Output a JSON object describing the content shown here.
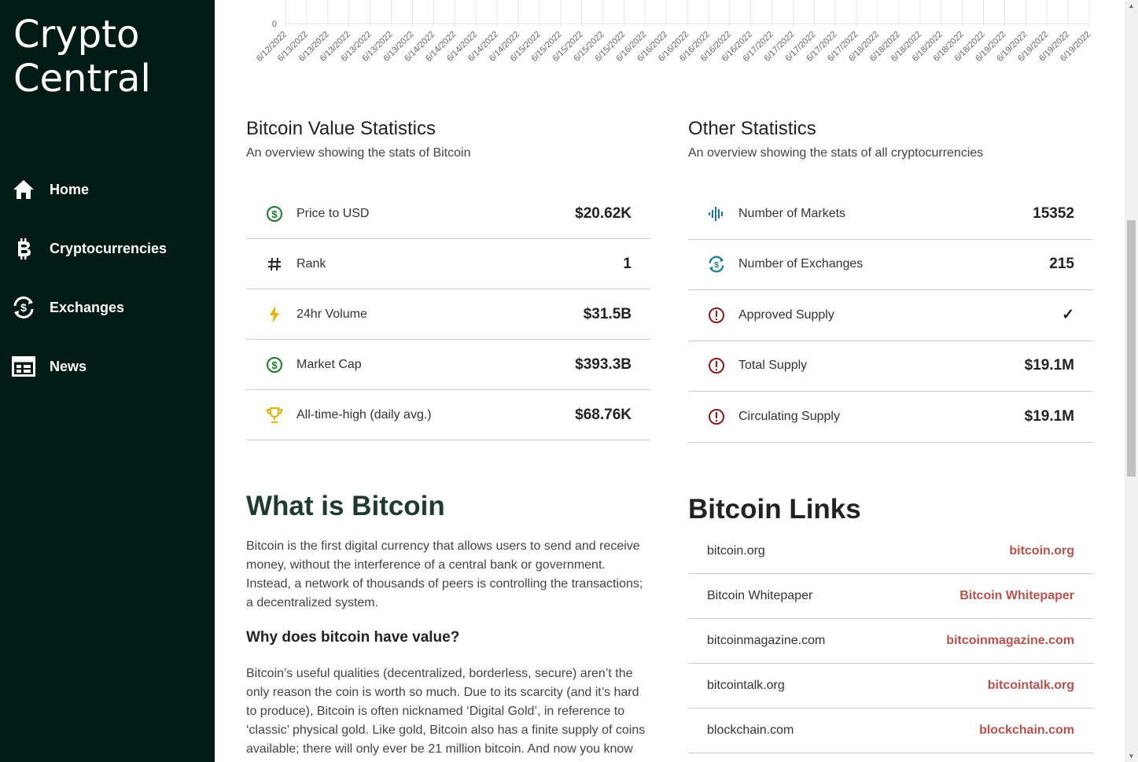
{
  "brand": {
    "line1": "Crypto",
    "line2": "Central"
  },
  "nav": [
    {
      "label": "Home",
      "icon": "home-icon"
    },
    {
      "label": "Cryptocurrencies",
      "icon": "bitcoin-icon"
    },
    {
      "label": "Exchanges",
      "icon": "exchange-icon"
    },
    {
      "label": "News",
      "icon": "news-icon"
    }
  ],
  "chart_data": {
    "type": "line",
    "y_tick_visible": "0",
    "x": [
      "6/12/2022",
      "6/13/2022",
      "6/13/2022",
      "6/13/2022",
      "6/13/2022",
      "6/13/2022",
      "6/13/2022",
      "6/14/2022",
      "6/14/2022",
      "6/14/2022",
      "6/14/2022",
      "6/14/2022",
      "6/15/2022",
      "6/15/2022",
      "6/15/2022",
      "6/15/2022",
      "6/15/2022",
      "6/16/2022",
      "6/16/2022",
      "6/16/2022",
      "6/16/2022",
      "6/16/2022",
      "6/16/2022",
      "6/17/2022",
      "6/17/2022",
      "6/17/2022",
      "6/17/2022",
      "6/17/2022",
      "6/18/2022",
      "6/18/2022",
      "6/18/2022",
      "6/18/2022",
      "6/18/2022",
      "6/18/2022",
      "6/19/2022",
      "6/19/2022",
      "6/19/2022",
      "6/19/2022",
      "6/19/2022"
    ]
  },
  "bitcoin_stats": {
    "title": "Bitcoin Value Statistics",
    "subtitle": "An overview showing the stats of Bitcoin",
    "rows": [
      {
        "label": "Price to USD",
        "value": "$20.62K",
        "icon": "dollar-circle-icon",
        "color": "#1e7a2e"
      },
      {
        "label": "Rank",
        "value": "1",
        "icon": "hash-icon",
        "color": "#222222"
      },
      {
        "label": "24hr Volume",
        "value": "$31.5B",
        "icon": "lightning-icon",
        "color": "#e0b400"
      },
      {
        "label": "Market Cap",
        "value": "$393.3B",
        "icon": "dollar-circle-icon",
        "color": "#1e7a2e"
      },
      {
        "label": "All-time-high (daily avg.)",
        "value": "$68.76K",
        "icon": "trophy-icon",
        "color": "#e0b400"
      }
    ]
  },
  "other_stats": {
    "title": "Other Statistics",
    "subtitle": "An overview showing the stats of all cryptocurrencies",
    "rows": [
      {
        "label": "Number of Markets",
        "value": "15352",
        "icon": "soundwave-icon",
        "color": "#1a7a8a"
      },
      {
        "label": "Number of Exchanges",
        "value": "215",
        "icon": "exchange-icon",
        "color": "#1a7a8a"
      },
      {
        "label": "Approved Supply",
        "value": "✓",
        "icon": "exclamation-circle-icon",
        "color": "#8a1a1a"
      },
      {
        "label": "Total Supply",
        "value": "$19.1M",
        "icon": "exclamation-circle-icon",
        "color": "#8a1a1a"
      },
      {
        "label": "Circulating Supply",
        "value": "$19.1M",
        "icon": "exclamation-circle-icon",
        "color": "#8a1a1a"
      }
    ]
  },
  "about": {
    "title": "What is Bitcoin",
    "p1": "Bitcoin is the first digital currency that allows users to send and receive money, without the interference of a central bank or government. Instead, a network of thousands of peers is controlling the transactions; a decentralized system.",
    "h2": "Why does bitcoin have value?",
    "p2": "Bitcoin’s useful qualities (decentralized, borderless, secure) aren’t the only reason the coin is worth so much. Due to its scarcity (and it’s hard to produce), Bitcoin is often nicknamed ‘Digital Gold’, in reference to ‘classic’ physical gold. Like gold, Bitcoin also has a finite supply of coins available; there will only ever be 21 million bitcoin. And now you know"
  },
  "links": {
    "title": "Bitcoin Links",
    "rows": [
      {
        "label": "bitcoin.org",
        "value": "bitcoin.org"
      },
      {
        "label": "Bitcoin Whitepaper",
        "value": "Bitcoin Whitepaper"
      },
      {
        "label": "bitcoinmagazine.com",
        "value": "bitcoinmagazine.com"
      },
      {
        "label": "bitcointalk.org",
        "value": "bitcointalk.org"
      },
      {
        "label": "blockchain.com",
        "value": "blockchain.com"
      }
    ]
  }
}
